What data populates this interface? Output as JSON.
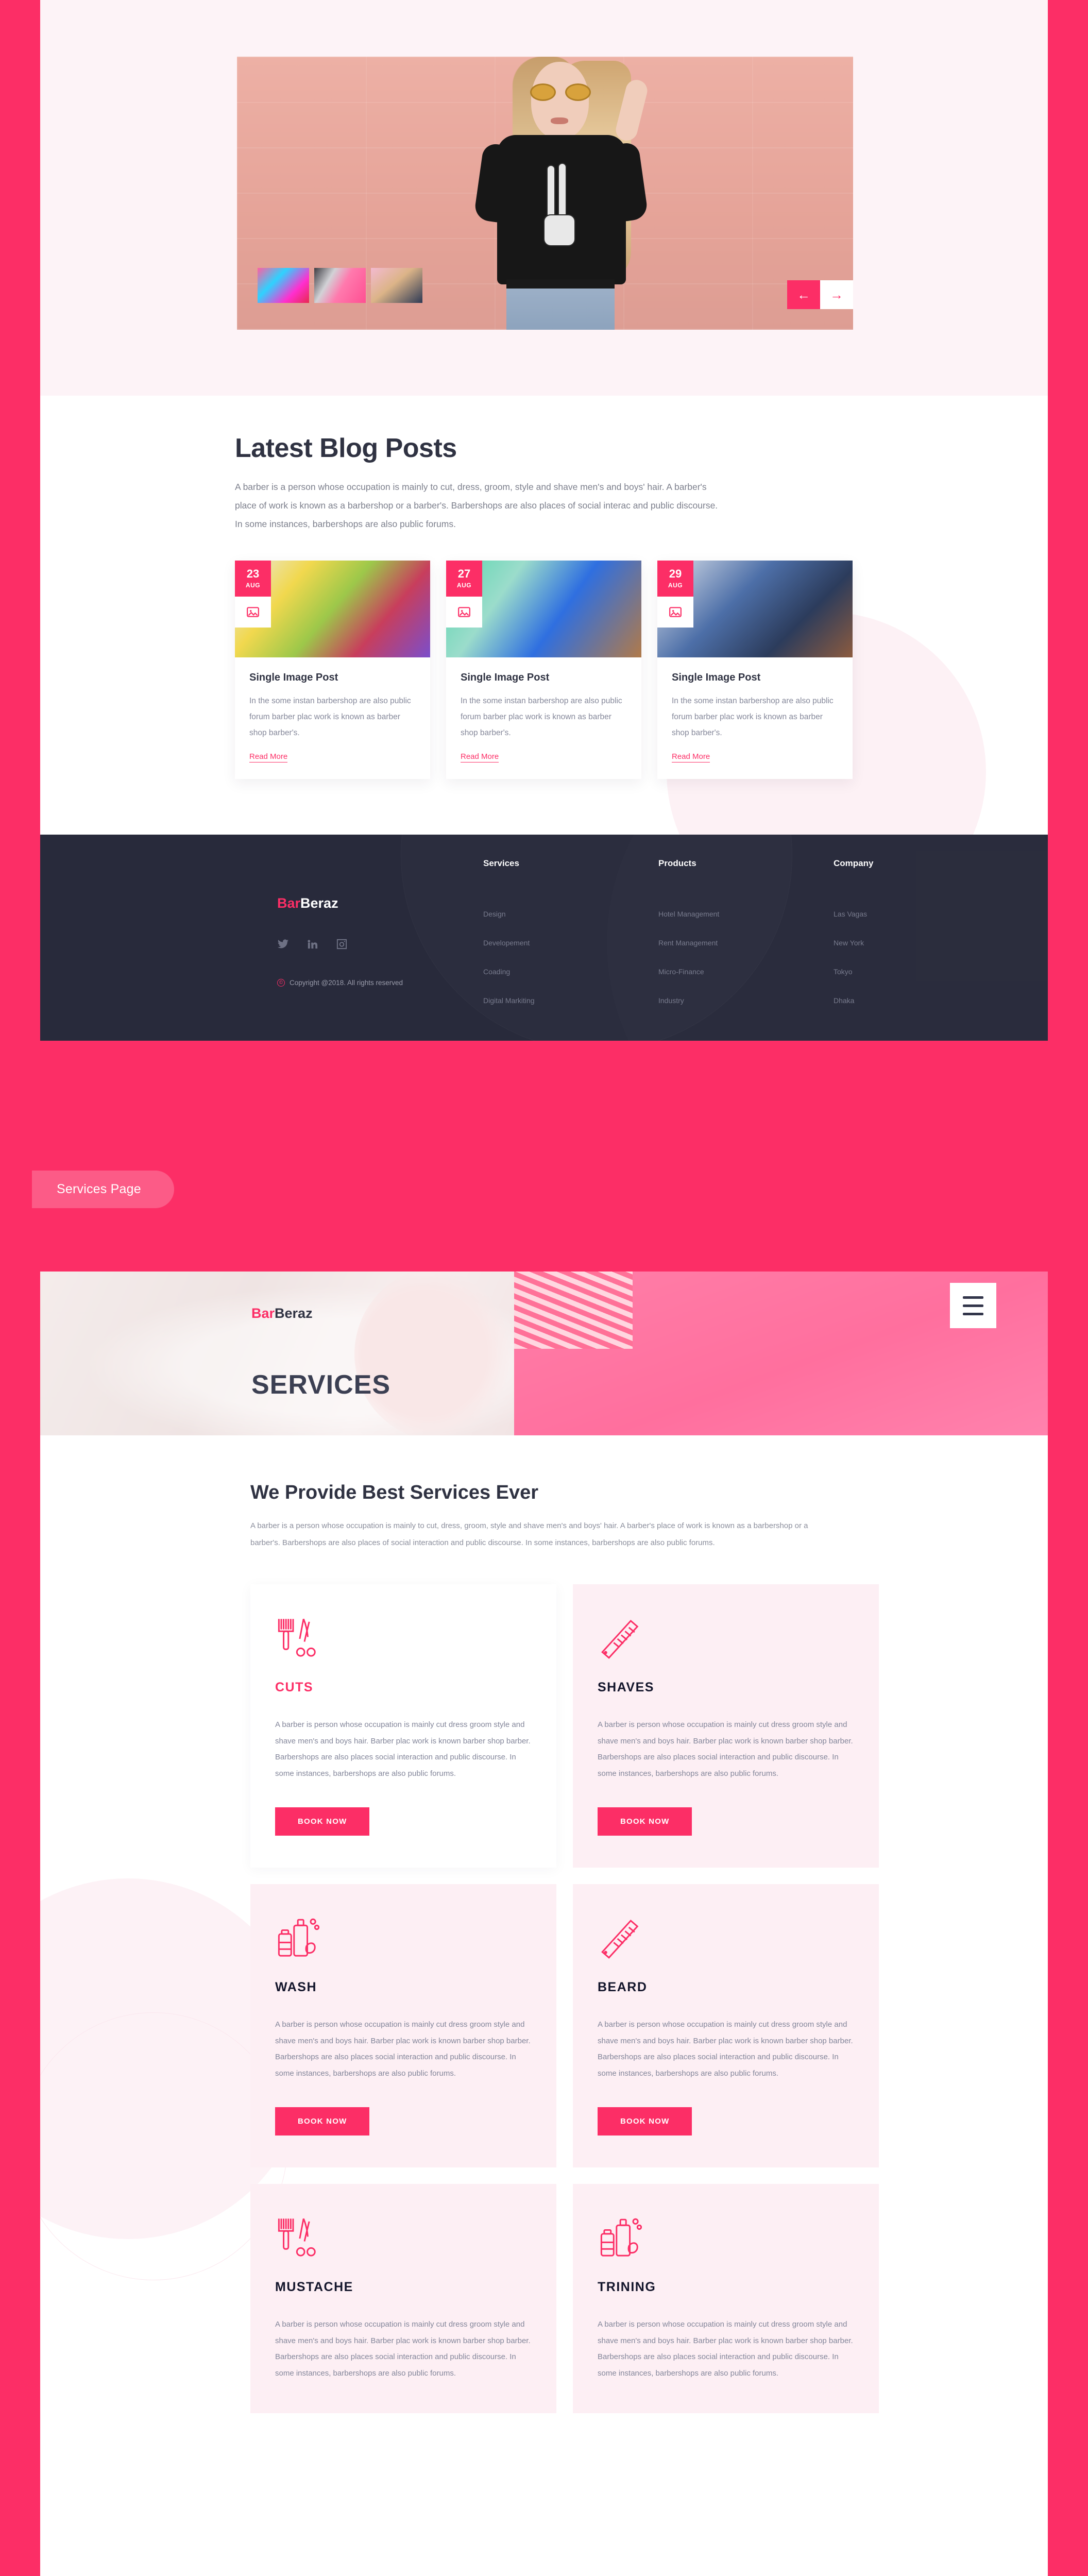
{
  "theme": {
    "accent": "#FC2E66",
    "dark": "#282A3B",
    "soft_pink": "#FDEFF4",
    "hero_bg": "#FDF3F7"
  },
  "hero": {
    "prev_arrow": "←",
    "next_arrow": "→",
    "thumbnails": [
      "lollipop-thumbnail",
      "headphones-thumbnail",
      "portrait-thumbnail"
    ]
  },
  "blog": {
    "title": "Latest Blog Posts",
    "description": "A barber is a person whose occupation is mainly to cut, dress, groom, style and shave men's and boys' hair. A barber's place of work is known as a barbershop or a barber's. Barbershops are also places of social interac and public discourse. In some instances, barbershops are also public forums.",
    "posts": [
      {
        "day": "23",
        "month": "AUG",
        "title": "Single Image Post",
        "excerpt": "In the some instan barbershop are also public forum barber plac work is known as barber shop barber's.",
        "read_more": "Read More"
      },
      {
        "day": "27",
        "month": "AUG",
        "title": "Single Image Post",
        "excerpt": "In the some instan barbershop are also public forum barber plac work is known as barber shop barber's.",
        "read_more": "Read More"
      },
      {
        "day": "29",
        "month": "AUG",
        "title": "Single Image Post",
        "excerpt": "In the some instan barbershop are also public forum barber plac work is known as barber shop barber's.",
        "read_more": "Read More"
      }
    ]
  },
  "footer": {
    "logo_accent": "Bar",
    "logo_rest": "Beraz",
    "copyright": "Copyright @2018. All rights reserved",
    "copyright_symbol": "©",
    "social": [
      "twitter-icon",
      "linkedin-icon",
      "instagram-icon"
    ],
    "columns": [
      {
        "heading": "Services",
        "links": [
          "Design",
          "Developement",
          "Coading",
          "Digital Markiting"
        ]
      },
      {
        "heading": "Products",
        "links": [
          "Hotel Management",
          "Rent Management",
          "Micro-Finance",
          "Industry"
        ]
      },
      {
        "heading": "Company",
        "links": [
          "Las Vagas",
          "New York",
          "Tokyo",
          "Dhaka"
        ]
      }
    ]
  },
  "page_label": "Services Page",
  "services_page": {
    "logo_accent": "Bar",
    "logo_rest": "Beraz",
    "hero_title": "SERVICES",
    "menu_icon": "hamburger-menu-icon",
    "section_title": "We Provide Best Services Ever",
    "section_description": "A barber is a person whose occupation is mainly to cut, dress, groom, style and shave men's and boys' hair. A barber's place of work is known as a barbershop or a barber's. Barbershops are also places of social interaction and public discourse. In some instances, barbershops are also public forums.",
    "body_text": "A barber is person whose occupation is mainly cut dress groom style and shave men's and boys hair. Barber plac work is known barber shop barber. Barbershops are also places social interaction and public discourse. In some instances, barbershops are also public forums.",
    "book_label": "BOOK NOW",
    "cards": [
      {
        "name": "CUTS",
        "icon": "comb-and-scissors-icon",
        "style": "white"
      },
      {
        "name": "SHAVES",
        "icon": "comb-icon",
        "style": "pink"
      },
      {
        "name": "WASH",
        "icon": "shampoo-bottles-icon",
        "style": "pink"
      },
      {
        "name": "BEARD",
        "icon": "comb-icon",
        "style": "pink"
      },
      {
        "name": "MUSTACHE",
        "icon": "comb-and-scissors-icon",
        "style": "pink"
      },
      {
        "name": "TRINING",
        "icon": "shampoo-bottles-icon",
        "style": "pink"
      }
    ]
  }
}
